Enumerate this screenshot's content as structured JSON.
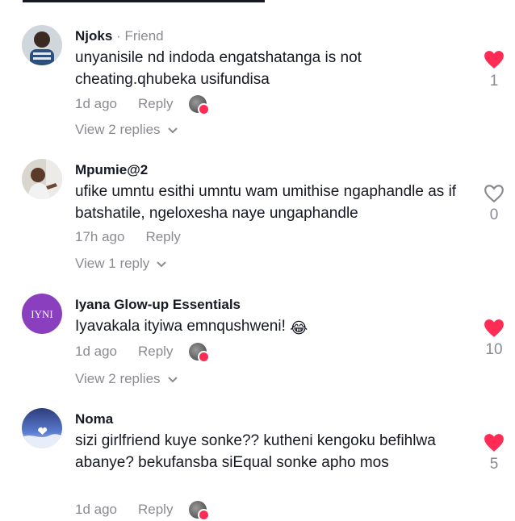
{
  "comments": [
    {
      "username": "Njoks",
      "separator": "·",
      "tag": "Friend",
      "text": "unyanisile nd indoda engatshatanga is not cheating.qhubeka usifundisa",
      "time": "1d ago",
      "reply_label": "Reply",
      "view_replies": "View 2 replies",
      "likes": "1",
      "liked": true,
      "creator_liked": true
    },
    {
      "username": "Mpumie@2",
      "text": "ufike umntu esithi umntu wam umithise ngaphandle as if batshatile, ngeloxesha naye ungaphandle",
      "time": "17h ago",
      "reply_label": "Reply",
      "view_replies": "View 1 reply",
      "likes": "0",
      "liked": false,
      "creator_liked": false
    },
    {
      "username": "Iyana Glow-up Essentials",
      "avatar_text": "IYNI",
      "text": "Iyavakala ityiwa emnqushweni!",
      "emoji": "😂",
      "time": "1d ago",
      "reply_label": "Reply",
      "view_replies": "View 2 replies",
      "likes": "10",
      "liked": true,
      "creator_liked": true
    },
    {
      "username": "Noma",
      "text": "sizi girlfriend kuye sonke?? kutheni kengoku befihlwa abanye? bekufansba siEqual sonke apho mos",
      "time": "1d ago",
      "reply_label": "Reply",
      "likes": "5",
      "liked": true,
      "creator_liked": true
    }
  ],
  "colors": {
    "like_red": "#fe2c55",
    "muted_gray": "#8a8b91",
    "text_dark": "#161823"
  },
  "icons": {
    "liked": "heart-filled-icon",
    "not_liked": "heart-outline-icon",
    "expand": "chevron-down-icon"
  }
}
